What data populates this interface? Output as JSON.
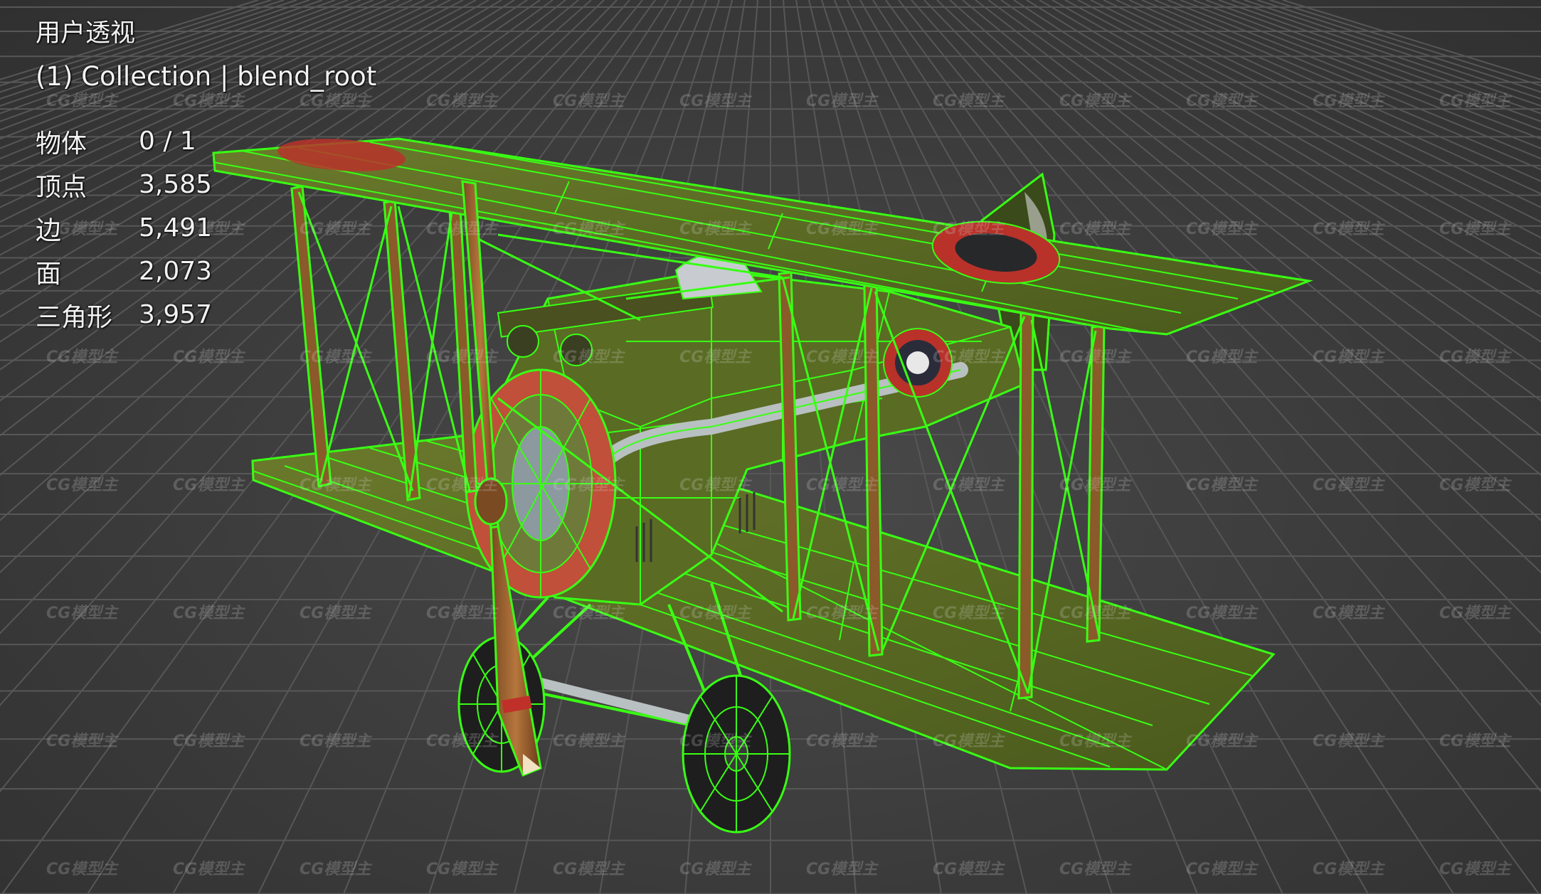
{
  "viewport": {
    "view_name": "用户透视",
    "collection_info": "(1) Collection | blend_root"
  },
  "stats": [
    {
      "label": "物体",
      "value": "0 / 1"
    },
    {
      "label": "顶点",
      "value": "3,585"
    },
    {
      "label": "边",
      "value": "5,491"
    },
    {
      "label": "面",
      "value": "2,073"
    },
    {
      "label": "三角形",
      "value": "3,957"
    }
  ],
  "watermark": {
    "text": "CG模型主"
  },
  "colors": {
    "wireframe": "#39ff14",
    "body": "#5a6b24",
    "roundel_red": "#b8322a",
    "grid": "#5a5a5a"
  }
}
